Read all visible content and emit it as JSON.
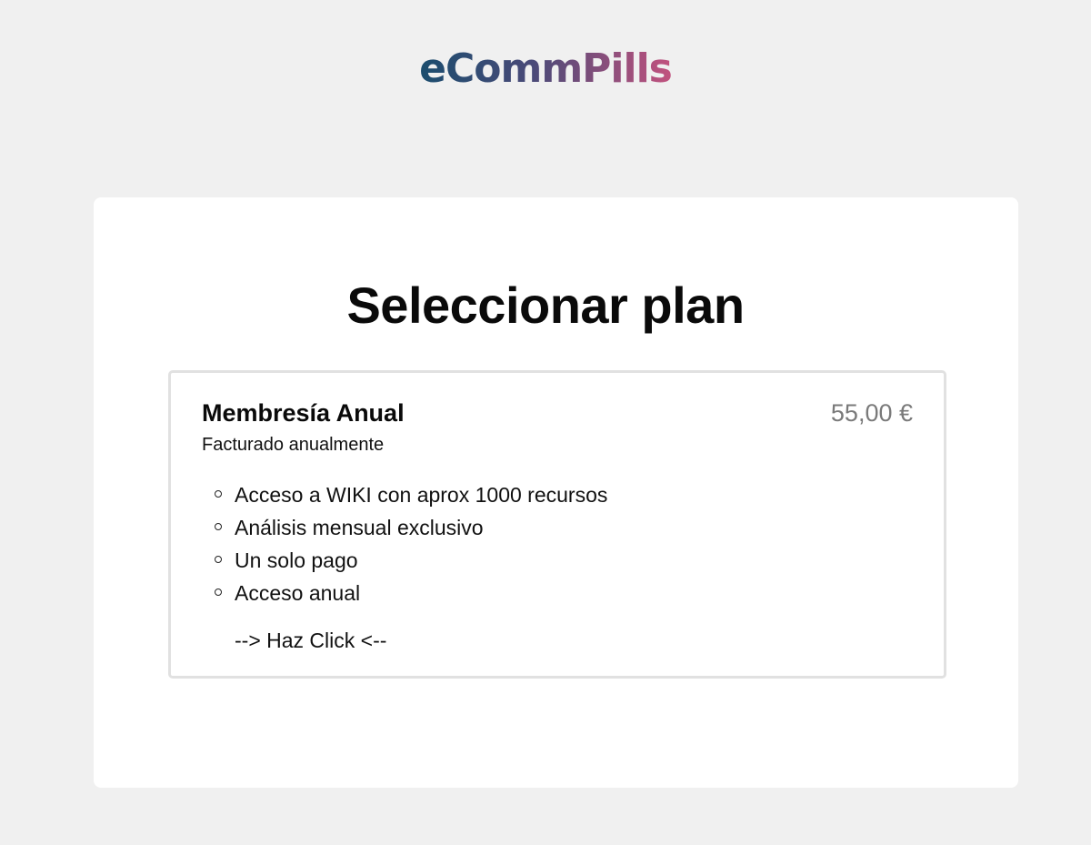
{
  "brand": {
    "logo_text": "eCommPills",
    "gradient_start": "#1b4d6e",
    "gradient_end": "#c2527e"
  },
  "page": {
    "title": "Seleccionar plan",
    "background": "#f0f0f0"
  },
  "plan": {
    "name": "Membresía Anual",
    "price": "55,00 €",
    "billing": "Facturado anualmente",
    "features": [
      "Acceso a WIKI con aprox 1000 recursos",
      "Análisis mensual exclusivo",
      "Un solo pago",
      "Acceso anual"
    ],
    "cta_label": "--> Haz Click <--",
    "bullet_icon": "hollow-circle-icon"
  }
}
